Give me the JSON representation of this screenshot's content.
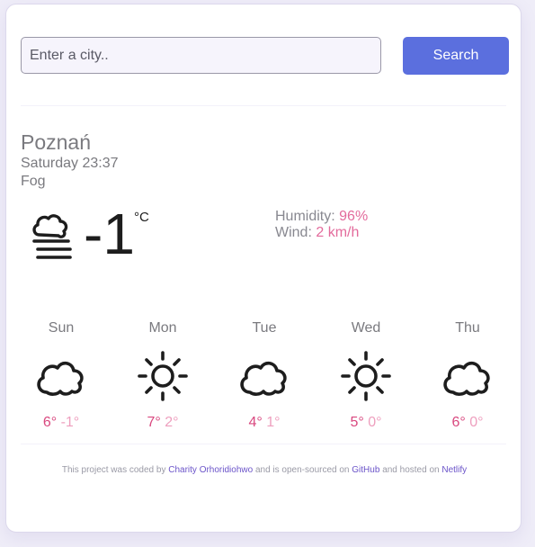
{
  "search": {
    "placeholder": "Enter a city..",
    "value": "",
    "button_label": "Search"
  },
  "current": {
    "city": "Poznań",
    "datetime": "Saturday 23:37",
    "description": "Fog",
    "icon": "fog-icon",
    "temperature": "-1",
    "unit": "°C",
    "humidity_label": "Humidity:",
    "humidity_value": "96%",
    "wind_label": "Wind:",
    "wind_value": "2 km/h"
  },
  "forecast": [
    {
      "day": "Sun",
      "icon": "cloud-icon",
      "max": "6°",
      "min": "-1°"
    },
    {
      "day": "Mon",
      "icon": "sun-icon",
      "max": "7°",
      "min": "2°"
    },
    {
      "day": "Tue",
      "icon": "cloud-icon",
      "max": "4°",
      "min": "1°"
    },
    {
      "day": "Wed",
      "icon": "sun-icon",
      "max": "5°",
      "min": "0°"
    },
    {
      "day": "Thu",
      "icon": "cloud-icon",
      "max": "6°",
      "min": "0°"
    }
  ],
  "footer": {
    "text_1": "This project was coded by",
    "author_link": "Charity Orhoridiohwo",
    "text_2": "and is open-sourced on",
    "github_link": "GitHub",
    "text_3": "and hosted on",
    "netlify_link": "Netlify"
  },
  "colors": {
    "accent": "#5b6fde",
    "max_temp": "#d9487f",
    "min_temp": "#ee9fbe",
    "link": "#6b54c9"
  }
}
